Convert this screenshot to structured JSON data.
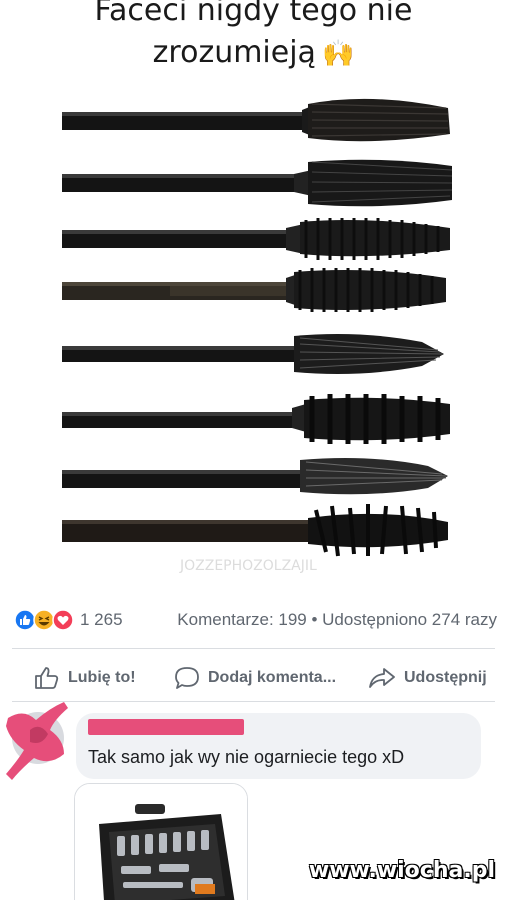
{
  "post": {
    "title_line1": "Faceci nigdy tego nie",
    "title_line2": "zrozumieją",
    "title_emoji": "raising-hands-icon",
    "image_watermark": "JOZZEPHOZOLZAJIL"
  },
  "reactions": {
    "icons": [
      "like-reaction-icon",
      "haha-reaction-icon",
      "love-reaction-icon"
    ],
    "count": "1 265",
    "stats": "Komentarze: 199 • Udostępniono 274 razy"
  },
  "actions": {
    "like": {
      "label": "Lubię to!",
      "icon": "thumbs-up-icon"
    },
    "comment": {
      "label": "Dodaj komenta...",
      "icon": "speech-bubble-icon"
    },
    "share": {
      "label": "Udostępnij",
      "icon": "share-arrow-icon"
    }
  },
  "comment": {
    "text": "Tak samo jak wy nie ogarniecie tego xD",
    "attachment": "toolbox-set-image"
  },
  "colors": {
    "like_blue": "#1877f2",
    "love_red": "#f33e58",
    "haha_yellow": "#f7b125",
    "redaction": "#e64e7a"
  },
  "site_watermark": "www.wiocha.pl"
}
